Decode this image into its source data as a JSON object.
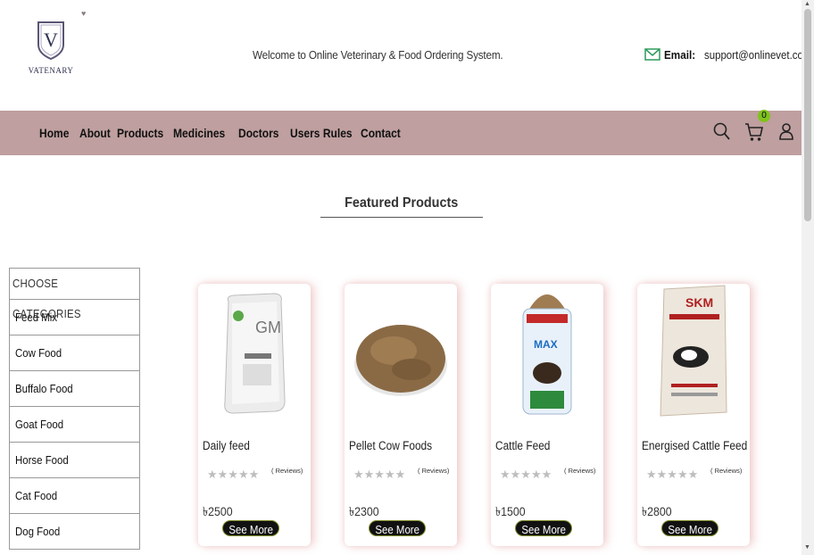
{
  "header": {
    "brand": "VATENARY",
    "welcome": "Welcome to Online Veterinary & Food Ordering System.",
    "email_label": "Email:",
    "email": "support@onlinevet.com"
  },
  "nav": {
    "items": [
      "Home",
      "About",
      "Products",
      "Medicines",
      "Doctors",
      "Users Rules",
      "Contact"
    ],
    "cart_count": "0"
  },
  "featured_title": "Featured Products",
  "categories": {
    "heading": "CHOOSE CATEGORIES",
    "items": [
      "Feed Mix",
      "Cow Food",
      "Buffalo Food",
      "Goat Food",
      "Horse Food",
      "Cat Food",
      "Dog Food"
    ]
  },
  "products": [
    {
      "name": "Daily feed",
      "stars": "★★★★★",
      "reviews": "( Reviews)",
      "price": "৳2500",
      "button": "See More"
    },
    {
      "name": "Pellet Cow Foods",
      "stars": "★★★★★",
      "reviews": "( Reviews)",
      "price": "৳2300",
      "button": "See More"
    },
    {
      "name": "Cattle Feed",
      "stars": "★★★★★",
      "reviews": "( Reviews)",
      "price": "৳1500",
      "button": "See More"
    },
    {
      "name": "Energised Cattle Feed",
      "stars": "★★★★★",
      "reviews": "( Reviews)",
      "price": "৳2800",
      "button": "See More"
    }
  ],
  "colors": {
    "nav_bg": "#bf9f9f",
    "badge": "#7fc31c",
    "button_bg": "#111111"
  }
}
